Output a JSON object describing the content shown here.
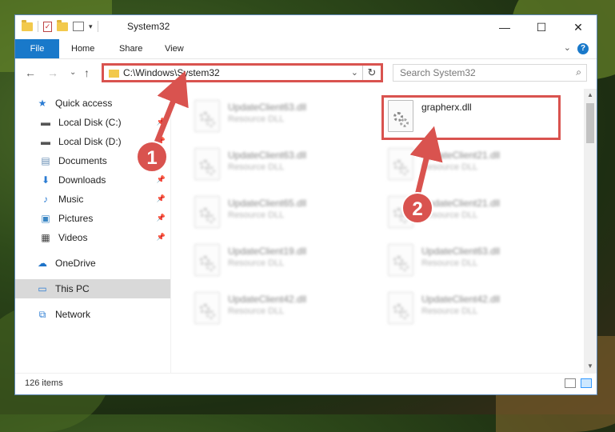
{
  "window": {
    "title": "System32",
    "minimize_glyph": "—",
    "maximize_glyph": "☐",
    "close_glyph": "✕"
  },
  "ribbon": {
    "file": "File",
    "home": "Home",
    "share": "Share",
    "view": "View",
    "help": "?",
    "expand_glyph": "⌄"
  },
  "address": {
    "path": "C:\\Windows\\System32",
    "dropdown_glyph": "⌄",
    "refresh_glyph": "↻"
  },
  "nav": {
    "back_glyph": "←",
    "forward_glyph": "→",
    "recent_glyph": "⌄",
    "up_glyph": "↑"
  },
  "search": {
    "placeholder": "Search System32"
  },
  "sidebar": {
    "items": [
      {
        "label": "Quick access",
        "icon": "star-icon"
      },
      {
        "label": "Local Disk (C:)",
        "icon": "drive-icon"
      },
      {
        "label": "Local Disk (D:)",
        "icon": "drive-icon"
      },
      {
        "label": "Documents",
        "icon": "documents-icon"
      },
      {
        "label": "Downloads",
        "icon": "downloads-icon"
      },
      {
        "label": "Music",
        "icon": "music-icon"
      },
      {
        "label": "Pictures",
        "icon": "pictures-icon"
      },
      {
        "label": "Videos",
        "icon": "videos-icon"
      },
      {
        "label": "OneDrive",
        "icon": "cloud-icon"
      },
      {
        "label": "This PC",
        "icon": "computer-icon"
      },
      {
        "label": "Network",
        "icon": "network-icon"
      }
    ]
  },
  "files": {
    "left": [
      {
        "name": "UpdateClient63.dll",
        "type": "Resource DLL"
      },
      {
        "name": "UpdateClient63.dll",
        "type": "Resource DLL"
      },
      {
        "name": "UpdateClient65.dll",
        "type": "Resource DLL"
      },
      {
        "name": "UpdateClient19.dll",
        "type": "Resource DLL"
      },
      {
        "name": "UpdateClient42.dll",
        "type": "Resource DLL"
      }
    ],
    "right": [
      {
        "name": "grapherx.dll",
        "type": ""
      },
      {
        "name": "UpdateClient21.dll",
        "type": "Resource DLL"
      },
      {
        "name": "UpdateClient21.dll",
        "type": "Resource DLL"
      },
      {
        "name": "UpdateClient63.dll",
        "type": "Resource DLL"
      },
      {
        "name": "UpdateClient42.dll",
        "type": "Resource DLL"
      }
    ]
  },
  "status": {
    "item_count": "126 items"
  },
  "annotations": {
    "marker1": "1",
    "marker2": "2",
    "accent_color": "#d9534f"
  }
}
